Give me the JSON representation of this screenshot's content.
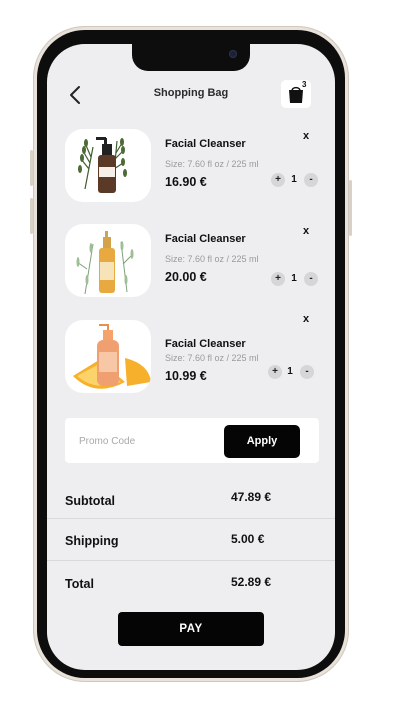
{
  "header": {
    "title": "Shopping Bag",
    "bag_count": "3"
  },
  "icons": {
    "back": "chevron-left-icon",
    "bag": "shopping-bag-icon",
    "remove": "close-icon",
    "increase": "plus-icon",
    "decrease": "minus-icon"
  },
  "items": [
    {
      "name": "Facial Cleanser",
      "size": "Size: 7.60 fl oz / 225 ml",
      "price": "16.90 €",
      "qty": "1",
      "remove": "x",
      "plus": "+",
      "minus": "-"
    },
    {
      "name": "Facial Cleanser",
      "size": "Size: 7.60 fl oz / 225 ml",
      "price": "20.00 €",
      "qty": "1",
      "remove": "x",
      "plus": "+",
      "minus": "-"
    },
    {
      "name": "Facial Cleanser",
      "size": "Size: 7.60 fl oz / 225 ml",
      "price": "10.99 €",
      "qty": "1",
      "remove": "x",
      "plus": "+",
      "minus": "-"
    }
  ],
  "promo": {
    "placeholder": "Promo Code",
    "value": "",
    "apply_label": "Apply"
  },
  "summary": {
    "subtotal_label": "Subtotal",
    "subtotal_value": "47.89 €",
    "shipping_label": "Shipping",
    "shipping_value": "5.00 €",
    "total_label": "Total",
    "total_value": "52.89 €"
  },
  "pay_label": "PAY",
  "colors": {
    "screen_bg": "#eeedf0",
    "card_bg": "#ffffff",
    "primary": "#050505",
    "muted_text": "#9a9a9a",
    "qty_button": "#d6d6d8"
  }
}
